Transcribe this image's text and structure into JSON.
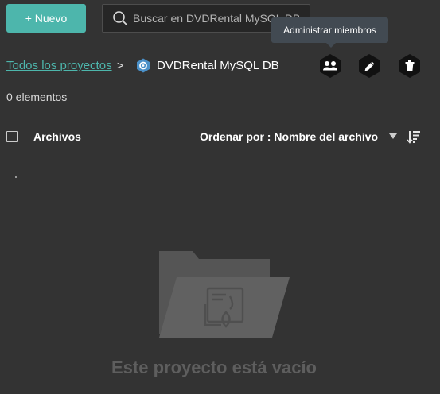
{
  "toolbar": {
    "new_button_label": "+ Nuevo"
  },
  "search": {
    "placeholder": "Buscar en DVDRental MySQL DB"
  },
  "tooltip": {
    "text": "Administrar miembros"
  },
  "breadcrumb": {
    "root_label": "Todos los proyectos",
    "separator": ">",
    "project_title": "DVDRental MySQL DB",
    "project_icon": "project-hex-icon"
  },
  "actions": [
    {
      "name": "manage-members",
      "icon": "members-icon"
    },
    {
      "name": "edit",
      "icon": "pencil-icon"
    },
    {
      "name": "delete",
      "icon": "trash-icon"
    }
  ],
  "summary": {
    "count_text": "0 elementos"
  },
  "list_header": {
    "files_label": "Archivos",
    "sort_label": "Ordenar por : Nombre del archivo"
  },
  "empty_state": {
    "message": "Este proyecto está vacío",
    "icon": "empty-folder-icon"
  },
  "colors": {
    "accent": "#4db6ac",
    "background": "#333333"
  }
}
